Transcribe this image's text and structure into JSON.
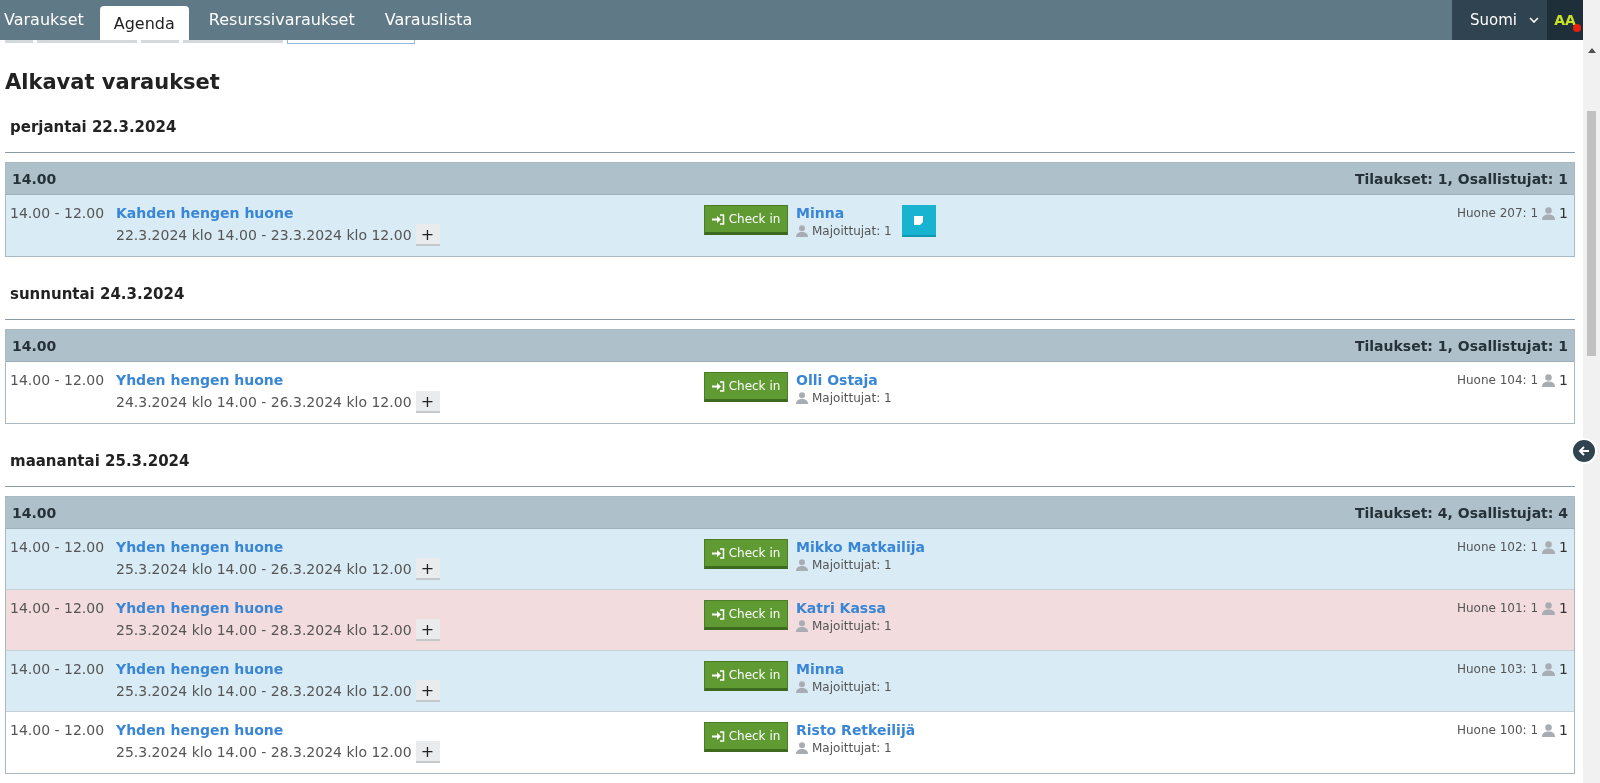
{
  "tabs": [
    {
      "label": "Varaukset",
      "selected": false
    },
    {
      "label": "Agenda",
      "selected": true
    },
    {
      "label": "Resurssivaraukset",
      "selected": false
    },
    {
      "label": "Varauslista",
      "selected": false
    }
  ],
  "language": "Suomi",
  "accessibility_label": "AA",
  "title": "Alkavat varaukset",
  "days": [
    {
      "date": "perjantai 22.3.2024",
      "groups": [
        {
          "time": "14.00",
          "summary": "Tilaukset: 1, Osallistujat: 1",
          "rows": [
            {
              "time": "14.00 - 12.00",
              "room_type": "Kahden hengen huone",
              "period": "22.3.2024 klo 14.00 - 23.3.2024 klo 12.00",
              "expand": "+",
              "checkin": "Check in",
              "guest": "Minna",
              "guests_label": "Majoittujat: 1",
              "has_note": true,
              "room": "Huone 207: 1",
              "persons": "1",
              "color": "#d9ebf5"
            }
          ]
        }
      ]
    },
    {
      "date": "sunnuntai 24.3.2024",
      "groups": [
        {
          "time": "14.00",
          "summary": "Tilaukset: 1, Osallistujat: 1",
          "rows": [
            {
              "time": "14.00 - 12.00",
              "room_type": "Yhden hengen huone",
              "period": "24.3.2024 klo 14.00 - 26.3.2024 klo 12.00",
              "expand": "+",
              "checkin": "Check in",
              "guest": "Olli Ostaja",
              "guests_label": "Majoittujat: 1",
              "has_note": false,
              "room": "Huone 104: 1",
              "persons": "1",
              "color": "#ffffff"
            }
          ]
        }
      ]
    },
    {
      "date": "maanantai 25.3.2024",
      "groups": [
        {
          "time": "14.00",
          "summary": "Tilaukset: 4, Osallistujat: 4",
          "rows": [
            {
              "time": "14.00 - 12.00",
              "room_type": "Yhden hengen huone",
              "period": "25.3.2024 klo 14.00 - 26.3.2024 klo 12.00",
              "expand": "+",
              "checkin": "Check in",
              "guest": "Mikko Matkailija",
              "guests_label": "Majoittujat: 1",
              "has_note": false,
              "room": "Huone 102: 1",
              "persons": "1",
              "color": "#d9ebf5"
            },
            {
              "time": "14.00 - 12.00",
              "room_type": "Yhden hengen huone",
              "period": "25.3.2024 klo 14.00 - 28.3.2024 klo 12.00",
              "expand": "+",
              "checkin": "Check in",
              "guest": "Katri Kassa",
              "guests_label": "Majoittujat: 1",
              "has_note": false,
              "room": "Huone 101: 1",
              "persons": "1",
              "color": "#f2dcdd"
            },
            {
              "time": "14.00 - 12.00",
              "room_type": "Yhden hengen huone",
              "period": "25.3.2024 klo 14.00 - 28.3.2024 klo 12.00",
              "expand": "+",
              "checkin": "Check in",
              "guest": "Minna",
              "guests_label": "Majoittujat: 1",
              "has_note": false,
              "room": "Huone 103: 1",
              "persons": "1",
              "color": "#d9ebf5"
            },
            {
              "time": "14.00 - 12.00",
              "room_type": "Yhden hengen huone",
              "period": "25.3.2024 klo 14.00 - 28.3.2024 klo 12.00",
              "expand": "+",
              "checkin": "Check in",
              "guest": "Risto Retkeilijä",
              "guests_label": "Majoittujat: 1",
              "has_note": false,
              "room": "Huone 100: 1",
              "persons": "1",
              "color": "#ffffff"
            }
          ]
        }
      ]
    }
  ]
}
